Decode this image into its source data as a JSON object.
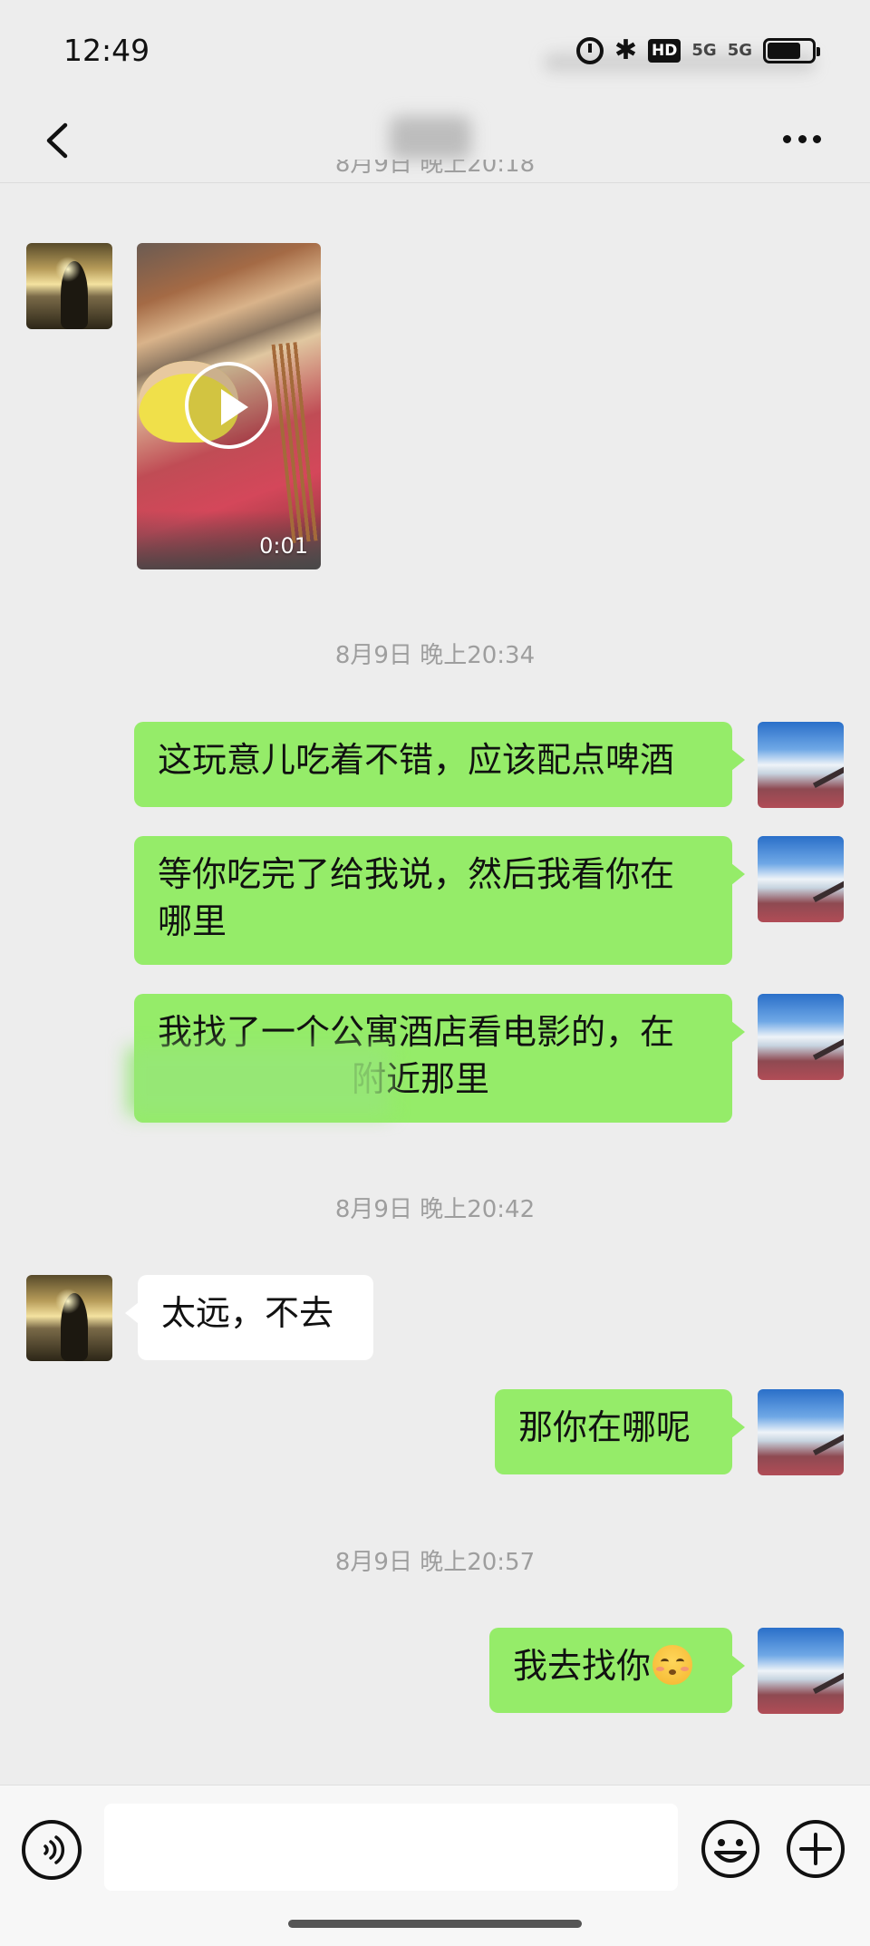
{
  "status_bar": {
    "time": "12:49",
    "icons": [
      "alarm-icon",
      "bluetooth-icon",
      "hd-icon",
      "signal-icon",
      "battery-icon"
    ],
    "hd_label": "HD",
    "signal_label_1": "5G",
    "signal_label_2": "5G"
  },
  "nav": {
    "back_icon": "chevron-left-icon",
    "more_icon": "more-dots-icon"
  },
  "messages": {
    "partial_timestamp": "8月9日 晚上20:18",
    "video": {
      "duration": "0:01"
    },
    "ts_1": "8月9日 晚上20:34",
    "me_1": "这玩意儿吃着不错，应该配点啤酒",
    "me_2_line1": "等你吃完了给我说，然后我看你在",
    "me_2_line2": "哪里",
    "me_3_line1": "我找了一个公寓酒店看电影的，在",
    "me_3_line2": "附近那里",
    "ts_2": "8月9日 晚上20:42",
    "friend_1": "太远，不去",
    "me_4": "那你在哪呢",
    "ts_3": "8月9日 晚上20:57",
    "me_5": "我去找你"
  },
  "input_bar": {
    "voice_icon": "voice-icon",
    "emoji_icon": "emoji-icon",
    "plus_icon": "plus-icon",
    "input_value": ""
  },
  "colors": {
    "bubble_me": "#95ec69",
    "bubble_friend": "#ffffff",
    "background": "#ededed",
    "timestamp": "#9e9e9e"
  }
}
